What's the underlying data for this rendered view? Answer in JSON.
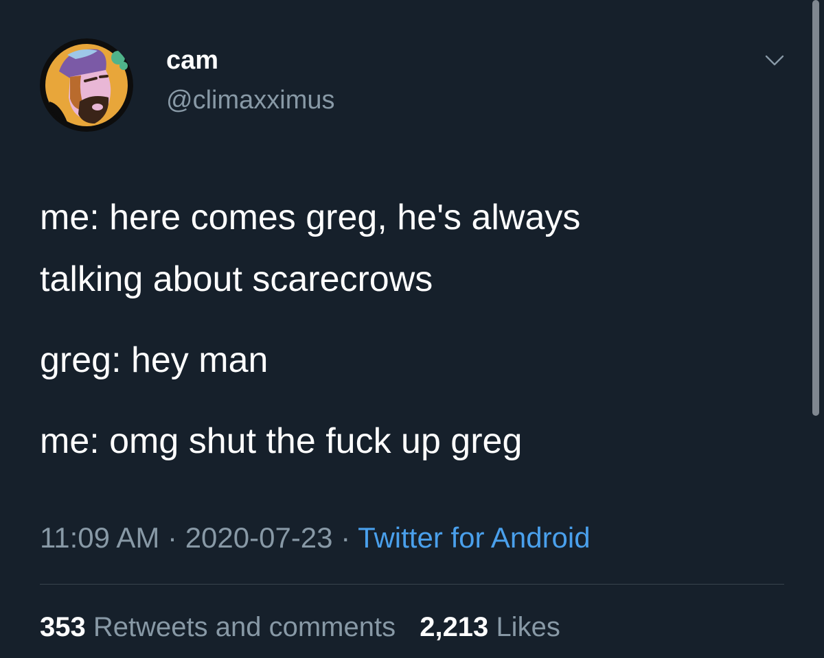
{
  "author": {
    "name": "cam",
    "handle": "@climaxximus"
  },
  "tweet": {
    "lines": [
      [
        "me: here comes greg, he's always",
        "talking about scarecrows"
      ],
      [
        "greg: hey man"
      ],
      [
        "me: omg shut the fuck up greg"
      ]
    ]
  },
  "meta": {
    "time": "11:09 AM",
    "separator": "·",
    "date": "2020-07-23",
    "source": "Twitter for Android"
  },
  "stats": {
    "retweets_count": "353",
    "retweets_label": "Retweets and comments",
    "likes_count": "2,213",
    "likes_label": "Likes"
  },
  "icons": {
    "caret": "chevron-down-icon",
    "avatar": "avatar"
  },
  "colors": {
    "background": "#16202b",
    "primary_text": "#ffffff",
    "secondary_text": "#8899a6",
    "link": "#4aa0ec",
    "divider": "#38444d"
  }
}
